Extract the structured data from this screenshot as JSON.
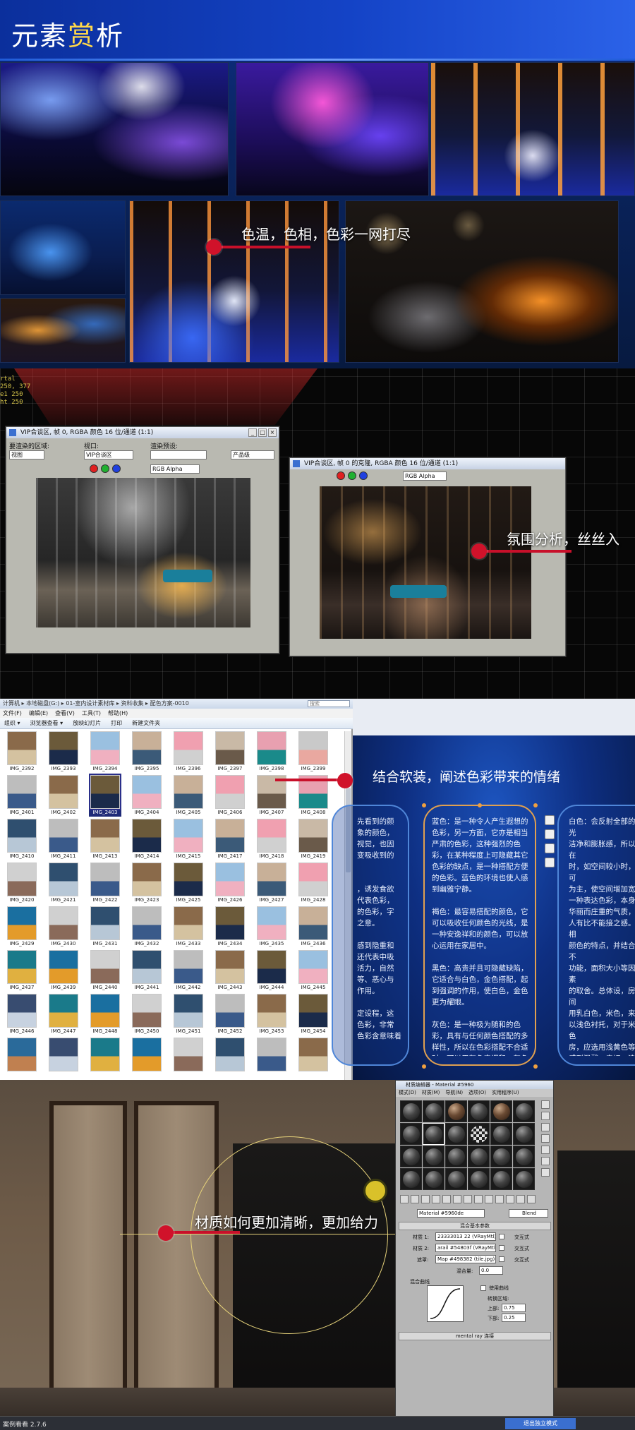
{
  "section1": {
    "title_main": "元素",
    "title_highlight": "赏",
    "title_tail": "析",
    "callout": "色温，色相，色彩一网打尽"
  },
  "section2": {
    "axis_labels": [
      "rtal",
      "250, 377",
      "e1 250",
      "ht 250"
    ],
    "window_a": {
      "title": "VIP合谈区, 帧 0, RGBA 颜色 16 位/通道 (1:1)",
      "area_label": "要渲染的区域:",
      "area_value": "视图",
      "viewport_label": "视口:",
      "viewport_value": "VIP合谈区",
      "preset_label": "渲染预设:",
      "preset_value": "",
      "render_value": "产品级",
      "channel_value": "RGB Alpha"
    },
    "window_b": {
      "title": "VIP合谈区, 帧 0 的克隆, RGBA 颜色 16 位/通道 (1:1)",
      "channel_value": "RGB Alpha"
    },
    "callout": "氛围分析，丝丝入"
  },
  "section3": {
    "address": "计算机 ▸ 本地磁盘(G:) ▸ 01-室内设计素材库 ▸ 资料收集 ▸ 配色方案-0010",
    "search": "搜索",
    "menu": [
      "文件(F)",
      "编辑(E)",
      "查看(V)",
      "工具(T)",
      "帮助(H)"
    ],
    "toolbar": [
      "组织 ▾",
      "浏览器查看 ▾",
      "放映幻灯片",
      "打印",
      "新建文件夹"
    ],
    "thumbs": [
      "IMG_2392",
      "IMG_2393",
      "IMG_2394",
      "IMG_2395",
      "IMG_2396",
      "IMG_2397",
      "IMG_2398",
      "IMG_2399",
      "IMG_2401",
      "IMG_2402",
      "IMG_2403",
      "IMG_2404",
      "IMG_2405",
      "IMG_2406",
      "IMG_2407",
      "IMG_2408",
      "IMG_2410",
      "IMG_2411",
      "IMG_2413",
      "IMG_2414",
      "IMG_2415",
      "IMG_2417",
      "IMG_2418",
      "IMG_2419",
      "IMG_2420",
      "IMG_2421",
      "IMG_2422",
      "IMG_2423",
      "IMG_2425",
      "IMG_2426",
      "IMG_2427",
      "IMG_2428",
      "IMG_2429",
      "IMG_2430",
      "IMG_2431",
      "IMG_2432",
      "IMG_2433",
      "IMG_2434",
      "IMG_2435",
      "IMG_2436",
      "IMG_2437",
      "IMG_2439",
      "IMG_2440",
      "IMG_2441",
      "IMG_2442",
      "IMG_2443",
      "IMG_2444",
      "IMG_2445",
      "IMG_2446",
      "IMG_2447",
      "IMG_2448",
      "IMG_2450",
      "IMG_2451",
      "IMG_2452",
      "IMG_2453",
      "IMG_2454",
      "",
      "",
      "",
      "",
      "",
      "",
      "",
      ""
    ],
    "selected_thumb": "IMG_2403",
    "heading": "结合软装，阐述色彩带来的情绪",
    "left_col": "先看到的颜\n象的颜色，\n视觉，也因\n变吸收到的\n\n\n，诱发食欲\n代表色彩，\n的色彩，字\n之意。\n\n感到隐重和\n还代表中吸\n活力，自然\n等、恶心与\n作用。\n\n定设程，这\n色彩，非常\n色彩含意味着",
    "mid_col": "蓝色：是一种令人产生遐想的色彩，另一方面，它亦是相当严肃的色彩，这种强烈的色彩，在某种程度上可隐藏其它色彩的缺点，是一种搭配方便的色彩。蓝色的环境也使人感到幽雅宁静。\n\n褐色：最容易搭配的颜色，它可以吸收任何颜色的光线，是一种安逸祥和的颜色，可以放心运用在家居中。\n\n黑色：高贵并且可隐藏缺陷，它适合与白色，金色搭配，起到强调的作用，使白色，金色更为耀眼。\n\n灰色：是一种极为随和的色彩，具有与任何颜色搭配的多样性，所以在色彩搭配不合适时，可以用灰色来调和。灰色可以算是中间色的代表。",
    "right_col": "白色：会反射全部的光\n洁净和膨胀感，所以在\n时，如空间较小时，可\n为主，使空间增加宽\n一种表达色彩，本身\n华丽而庄重的气质，\n人有比不能接之感。相\n颜色的特点，并结合不\n功能，面积大小等因素\n的取舍。总体设，房间\n用乳白色，米色，来\n以浅色衬托，对于米色\n房，应选用浅黄色等\n感到温馨，亲切，浪漫\n了明亮感，五色斑斓的\n，厨房里的橱柜颜了\n的喜好，然后通过主色\n厨房和餐厅的感觉。\n一定不变，以白色为主\n呈现朴素，淡雅，平和\n对于喜欢古净，安静的\n是最好的选择，空间\n色的搭配，会畅适出\n沉静效果，白色与任何\n会很和谐。"
  },
  "section4": {
    "editor": {
      "title": "材质编辑器 - Material #5960",
      "menu": [
        "模式(D)",
        "材质(M)",
        "导航(N)",
        "选项(O)",
        "实用程序(U)"
      ],
      "material_name": "Material #5960de",
      "material_type": "Blend",
      "rollout": "混合基本参数",
      "m1_label": "材质 1:",
      "m1_value": "23333013 22 (VRayMtl)",
      "m2_label": "材质 2:",
      "m2_value": "arail #54803f (VRayMtl)",
      "mask_label": "遮罩:",
      "mask_value": "Map #498382 (tile.jpg)",
      "interactive": "交互式",
      "mix_amount_label": "混合量:",
      "mix_amount": "0.0",
      "curve_label": "混合曲线",
      "use_curve": "使用曲线",
      "transition": "转换区域:",
      "upper_label": "上部:",
      "upper_value": "0.75",
      "lower_label": "下部:",
      "lower_value": "0.25",
      "mental_ray": "mental ray 连接"
    },
    "callout": "材质如何更加清晰，更加给力",
    "status_left": "案例看看 2.7.6",
    "status_right": "退出独立模式"
  }
}
